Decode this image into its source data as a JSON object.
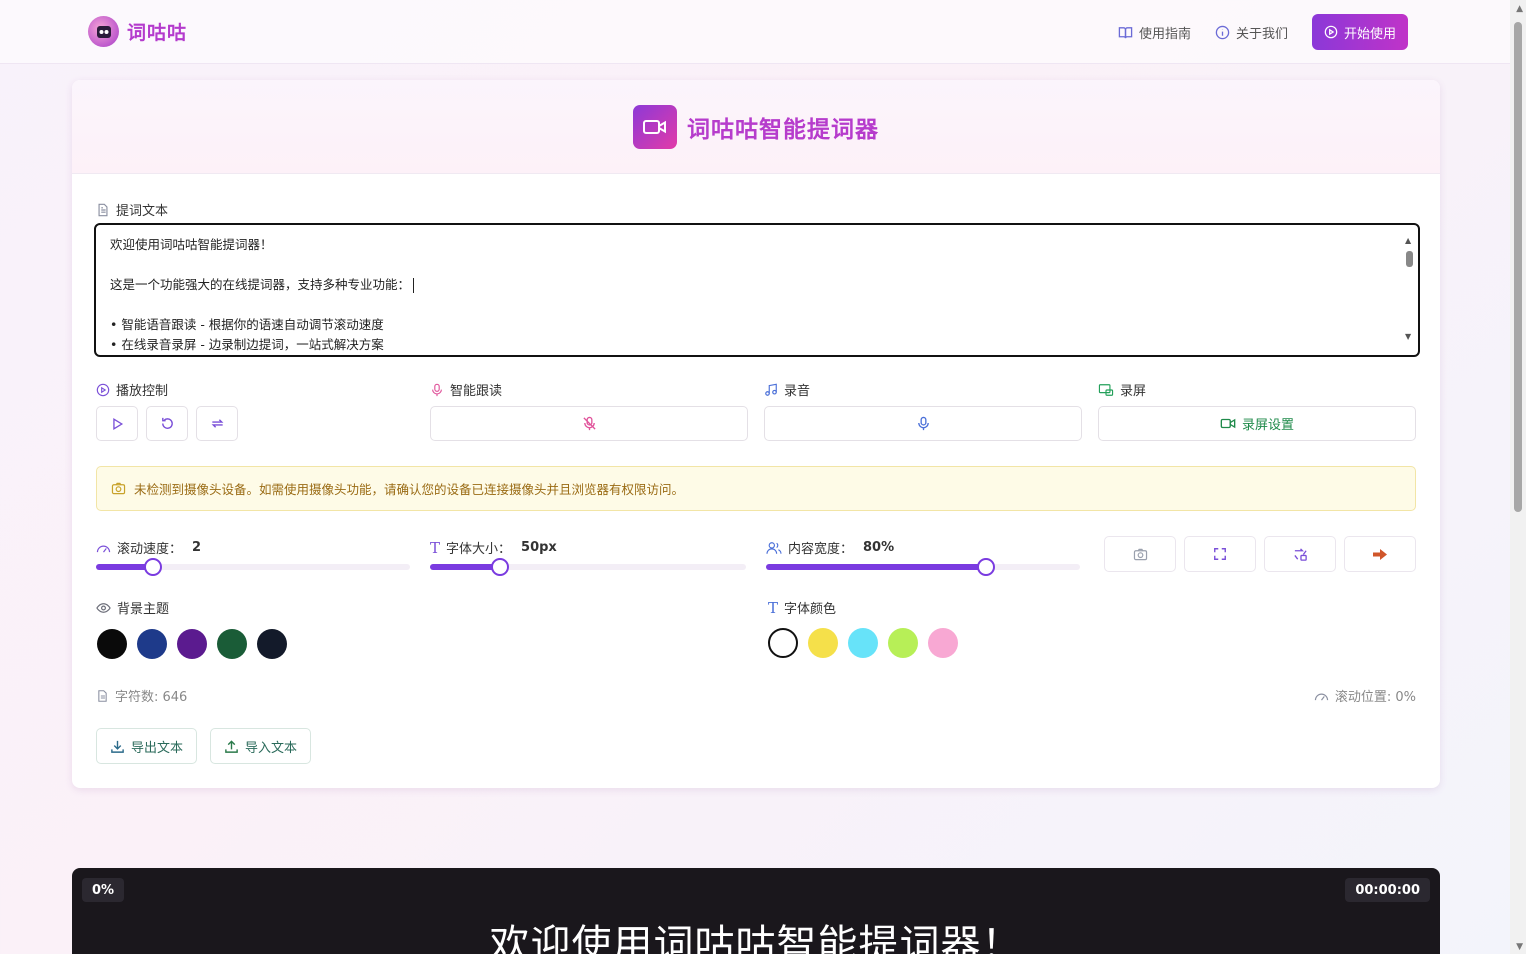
{
  "header": {
    "logo_text": "词咕咕",
    "nav": [
      {
        "label": "使用指南",
        "icon": "book-icon"
      },
      {
        "label": "关于我们",
        "icon": "info-icon"
      }
    ],
    "start_label": "开始使用"
  },
  "card": {
    "title": "词咕咕智能提词器",
    "text_label": "提词文本",
    "text_lines": [
      "欢迎使用词咕咕智能提词器！",
      "",
      "这是一个功能强大的在线提词器，支持多种专业功能：",
      "",
      "• 智能语音跟读 - 根据你的语速自动调节滚动速度",
      "• 在线录音录屏 - 边录制边提词，一站式解决方案"
    ],
    "sections": {
      "playback": "播放控制",
      "follow": "智能跟读",
      "record": "录音",
      "screen": "录屏",
      "screen_settings": "录屏设置"
    },
    "warning": "未检测到摄像头设备。如需使用摄像头功能，请确认您的设备已连接摄像头并且浏览器有权限访问。",
    "sliders": {
      "speed_label": "滚动速度：",
      "speed_value": "2",
      "speed_fraction": 0.18,
      "font_label": "字体大小：",
      "font_value": "50px",
      "font_fraction": 0.22,
      "width_label": "内容宽度：",
      "width_value": "80%",
      "width_fraction": 0.7
    },
    "bg_label": "背景主题",
    "bg_colors": [
      "#0a0a0a",
      "#1e3a8a",
      "#5b1b8f",
      "#1a5c37",
      "#131a2a"
    ],
    "font_color_label": "字体颜色",
    "font_colors": [
      "#ffffff",
      "#f5e04a",
      "#67e3f9",
      "#b7ef57",
      "#f8a8d3"
    ],
    "char_count": "字符数: 646",
    "scroll_pos": "滚动位置: 0%",
    "export_label": "导出文本",
    "import_label": "导入文本"
  },
  "preview": {
    "percent": "0%",
    "timer": "00:00:00",
    "text": "欢迎使用词咕咕智能提词器！"
  }
}
